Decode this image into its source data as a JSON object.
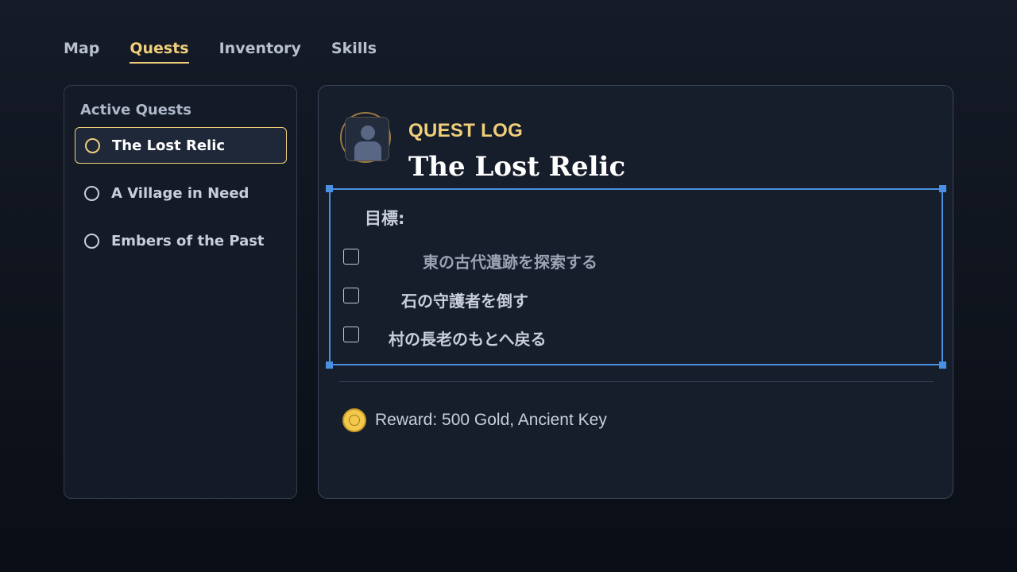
{
  "nav": {
    "tabs": [
      {
        "label": "Map",
        "active": false
      },
      {
        "label": "Quests",
        "active": true
      },
      {
        "label": "Inventory",
        "active": false
      },
      {
        "label": "Skills",
        "active": false
      }
    ]
  },
  "quest_list": {
    "title": "Active Quests",
    "items": [
      {
        "label": "The Lost Relic",
        "selected": true
      },
      {
        "label": "A Village in Need",
        "selected": false
      },
      {
        "label": "Embers of the Past",
        "selected": false
      }
    ]
  },
  "detail": {
    "section_label": "QUEST LOG",
    "quest_title": "The Lost Relic",
    "objectives_heading": "目標:",
    "objectives": [
      {
        "text": "東の古代遺跡を探索する",
        "checked": false
      },
      {
        "text": "石の守護者を倒す",
        "checked": false
      },
      {
        "text": "村の長老のもとへ戻る",
        "checked": false
      }
    ],
    "reward": "Reward: 500 Gold, Ancient Key"
  },
  "colors": {
    "accent": "#f0cf7a",
    "selection": "#4a90e2",
    "coin": "#f2c94c"
  }
}
